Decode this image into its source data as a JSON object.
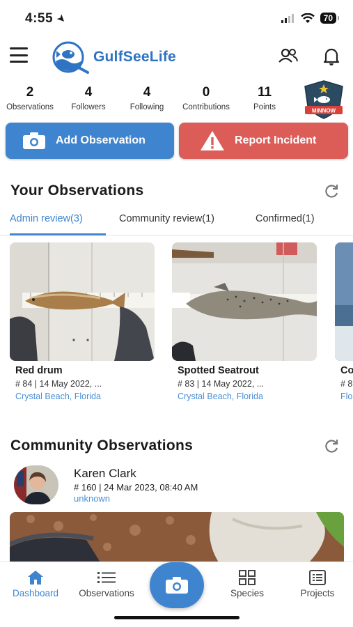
{
  "status_bar": {
    "time": "4:55",
    "battery": "70"
  },
  "app": {
    "name": "GulfSeeLife"
  },
  "stats": [
    {
      "value": "2",
      "label": "Observations"
    },
    {
      "value": "4",
      "label": "Followers"
    },
    {
      "value": "4",
      "label": "Following"
    },
    {
      "value": "0",
      "label": "Contributions"
    },
    {
      "value": "11",
      "label": "Points"
    }
  ],
  "badge": {
    "label": "MINNOW"
  },
  "actions": {
    "add_label": "Add Observation",
    "report_label": "Report Incident"
  },
  "your_observations": {
    "title": "Your Observations",
    "tabs": [
      {
        "label": "Admin review(3)"
      },
      {
        "label": "Community review(1)"
      },
      {
        "label": "Confirmed(1)"
      }
    ],
    "cards": [
      {
        "name": "Red drum",
        "meta": "# 84 |  14 May 2022, ...",
        "location": "Crystal Beach, Florida"
      },
      {
        "name": "Spotted Seatrout",
        "meta": "# 83 |  14 May 2022, ...",
        "location": "Crystal Beach, Florida"
      },
      {
        "name": "Co",
        "meta": "# 8",
        "location": "Flo"
      }
    ]
  },
  "community_observations": {
    "title": "Community Observations",
    "item": {
      "user": "Karen Clark",
      "meta": "# 160 |  24 Mar 2023, 08:40 AM",
      "location": "unknown"
    }
  },
  "bottom_nav": [
    {
      "label": "Dashboard"
    },
    {
      "label": "Observations"
    },
    {
      "label": "Species"
    },
    {
      "label": "Projects"
    }
  ],
  "colors": {
    "accent": "#3f84cf",
    "danger": "#dc5d57",
    "link": "#4a8fd6"
  }
}
